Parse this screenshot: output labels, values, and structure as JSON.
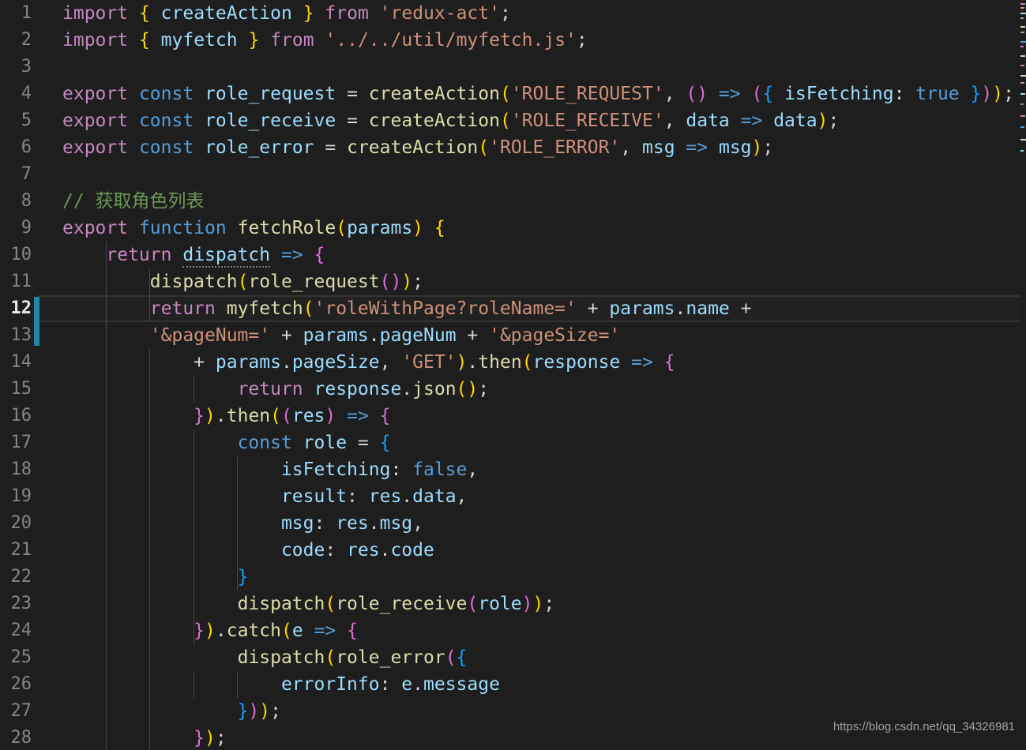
{
  "editor": {
    "language": "javascript",
    "theme": "dark-plus",
    "font_size_px": 23,
    "line_height_px": 34,
    "total_lines_visible": 28,
    "active_line": 12,
    "colors": {
      "background": "#1e1e1e",
      "gutter_number": "#858585",
      "gutter_number_active": "#e8e8e8",
      "active_line_border": "#333333",
      "cursor_marker": "#1f86a8",
      "indent_guide": "#474747",
      "keyword": "#c586c0",
      "declaration": "#569cd6",
      "variable": "#9cdcfe",
      "function": "#dcdcaa",
      "string": "#ce9178",
      "comment": "#6a9955",
      "punctuation": "#d4d4d4",
      "bracket_1": "#ffd700",
      "bracket_2": "#da70d6",
      "bracket_3": "#179fff"
    }
  },
  "line_numbers": [
    "1",
    "2",
    "3",
    "4",
    "5",
    "6",
    "7",
    "8",
    "9",
    "10",
    "11",
    "12",
    "13",
    "14",
    "15",
    "16",
    "17",
    "18",
    "19",
    "20",
    "21",
    "22",
    "23",
    "24",
    "25",
    "26",
    "27",
    "28"
  ],
  "code_lines": [
    {
      "n": 1,
      "text": "import { createAction } from 'redux-act';"
    },
    {
      "n": 2,
      "text": "import { myfetch } from '../../util/myfetch.js';"
    },
    {
      "n": 3,
      "text": ""
    },
    {
      "n": 4,
      "text": "export const role_request = createAction('ROLE_REQUEST', () => ({ isFetching: true }));"
    },
    {
      "n": 5,
      "text": "export const role_receive = createAction('ROLE_RECEIVE', data => data);"
    },
    {
      "n": 6,
      "text": "export const role_error = createAction('ROLE_ERROR', msg => msg);"
    },
    {
      "n": 7,
      "text": ""
    },
    {
      "n": 8,
      "text": "// 获取角色列表"
    },
    {
      "n": 9,
      "text": "export function fetchRole(params) {"
    },
    {
      "n": 10,
      "text": "    return dispatch => {"
    },
    {
      "n": 11,
      "text": "        dispatch(role_request());"
    },
    {
      "n": 12,
      "text": "        return myfetch('roleWithPage?roleName=' + params.name +"
    },
    {
      "n": 13,
      "text": "        '&pageNum=' + params.pageNum + '&pageSize='"
    },
    {
      "n": 14,
      "text": "            + params.pageSize, 'GET').then(response => {"
    },
    {
      "n": 15,
      "text": "                return response.json();"
    },
    {
      "n": 16,
      "text": "            }).then((res) => {"
    },
    {
      "n": 17,
      "text": "                const role = {"
    },
    {
      "n": 18,
      "text": "                    isFetching: false,"
    },
    {
      "n": 19,
      "text": "                    result: res.data,"
    },
    {
      "n": 20,
      "text": "                    msg: res.msg,"
    },
    {
      "n": 21,
      "text": "                    code: res.code"
    },
    {
      "n": 22,
      "text": "                }"
    },
    {
      "n": 23,
      "text": "                dispatch(role_receive(role));"
    },
    {
      "n": 24,
      "text": "            }).catch(e => {"
    },
    {
      "n": 25,
      "text": "                dispatch(role_error({"
    },
    {
      "n": 26,
      "text": "                    errorInfo: e.message"
    },
    {
      "n": 27,
      "text": "                }));"
    },
    {
      "n": 28,
      "text": "            });"
    }
  ],
  "comment_text": "// 获取角色列表",
  "watermark": {
    "text": "https://blog.csdn.net/qq_34326981"
  }
}
